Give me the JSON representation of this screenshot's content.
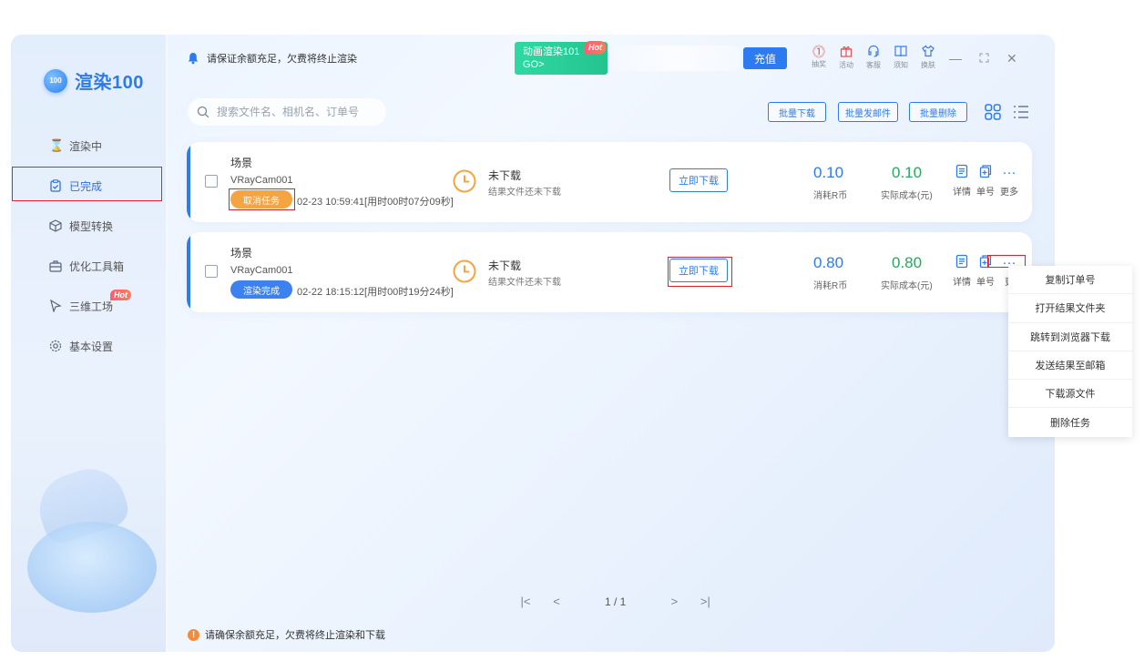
{
  "app": {
    "logo_badge": "100",
    "logo_text": "渲染100"
  },
  "sidebar": {
    "items": [
      {
        "label": "渲染中",
        "icon": "hourglass-icon"
      },
      {
        "label": "已完成",
        "icon": "clipboard-check-icon"
      },
      {
        "label": "模型转换",
        "icon": "cube-icon"
      },
      {
        "label": "优化工具箱",
        "icon": "toolbox-icon"
      },
      {
        "label": "三维工场",
        "icon": "cursor-3d-icon",
        "badge": "Hot"
      },
      {
        "label": "基本设置",
        "icon": "gear-icon"
      }
    ]
  },
  "topbar": {
    "notice": "请保证余额充足，欠费将终止渲染",
    "promo": {
      "title": "动画渲染101",
      "sub": "GO>",
      "badge": "Hot"
    },
    "recharge": "充值",
    "tools": [
      {
        "label": "抽奖",
        "icon": "prize-icon"
      },
      {
        "label": "活动",
        "icon": "gift-icon"
      },
      {
        "label": "客服",
        "icon": "headset-icon"
      },
      {
        "label": "须知",
        "icon": "book-icon"
      },
      {
        "label": "换肤",
        "icon": "shirt-icon"
      }
    ]
  },
  "toolbar": {
    "search_placeholder": "搜索文件名、相机名、订单号",
    "batch_download": "批量下载",
    "batch_mail": "批量发邮件",
    "batch_delete": "批量删除"
  },
  "tasks": [
    {
      "scene": "场景",
      "camera": "VRayCam001",
      "status": "取消任务",
      "time": "02-23 10:59:41[用时00时07分09秒]",
      "download_title": "未下载",
      "download_sub": "结果文件还未下载",
      "download_btn": "立即下载",
      "rcoin": "0.10",
      "rcoin_label": "消耗R币",
      "cost": "0.10",
      "cost_label": "实际成本(元)",
      "actions": [
        "详情",
        "单号",
        "更多"
      ]
    },
    {
      "scene": "场景",
      "camera": "VRayCam001",
      "status": "渲染完成",
      "time": "02-22 18:15:12[用时00时19分24秒]",
      "download_title": "未下载",
      "download_sub": "结果文件还未下载",
      "download_btn": "立即下载",
      "rcoin": "0.80",
      "rcoin_label": "消耗R币",
      "cost": "0.80",
      "cost_label": "实际成本(元)",
      "actions": [
        "详情",
        "单号",
        "更"
      ]
    }
  ],
  "context_menu": [
    "复制订单号",
    "打开结果文件夹",
    "跳转到浏览器下载",
    "发送结果至邮箱",
    "下载源文件",
    "删除任务"
  ],
  "pager": {
    "pages": "1 / 1"
  },
  "footer": {
    "notice": "请确保余额充足，欠费将终止渲染和下载"
  },
  "colors": {
    "accent": "#2c7bf0",
    "green": "#27a85f",
    "orange": "#f5a442",
    "highlight": "#d9232f"
  }
}
